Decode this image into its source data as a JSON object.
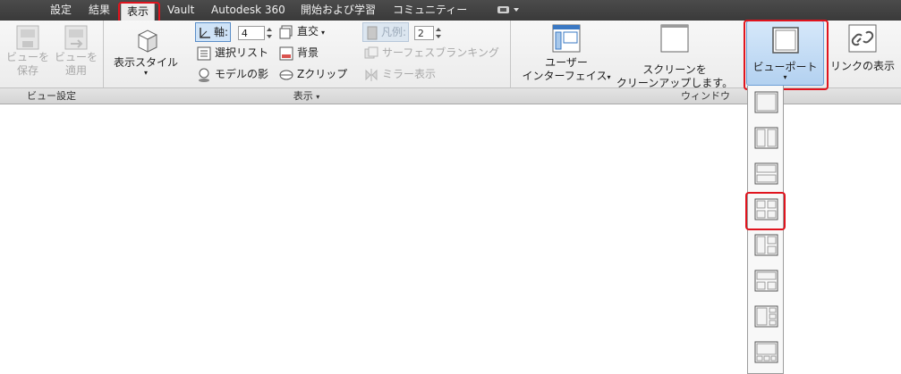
{
  "tabs": [
    "設定",
    "結果",
    "表示",
    "Vault",
    "Autodesk 360",
    "開始および学習",
    "コミュニティー"
  ],
  "active_tab": "表示",
  "view_settings": {
    "title": "ビュー設定",
    "save_view": [
      "ビューを",
      "保存"
    ],
    "apply_view": [
      "ビューを",
      "適用"
    ]
  },
  "display": {
    "title": "表示",
    "display_style": "表示スタイル",
    "axis_label": "軸:",
    "axis_value": "4",
    "select_list": "選択リスト",
    "model_shadow": "モデルの影",
    "ortho": "直交",
    "background": "背景",
    "zclip": "Zクリップ",
    "legend_label": "凡例:",
    "legend_value": "2",
    "surface_blanking": "サーフェスブランキング",
    "mirror_display": "ミラー表示"
  },
  "window": {
    "title": "ウィンドウ",
    "user_interface": [
      "ユーザー",
      "インターフェイス"
    ],
    "cleanup": [
      "スクリーンを",
      "クリーンアップします。"
    ],
    "viewport": "ビューポート",
    "link_display": "リンクの表示"
  },
  "viewport_options": [
    "single",
    "two-vertical",
    "two-horizontal",
    "four",
    "three-left",
    "three-top",
    "three-right",
    "four-bottom"
  ],
  "colors": {
    "highlight_red": "#e0141e",
    "tab_bar": "#444444",
    "selected_blue": "#b9d6f2"
  }
}
